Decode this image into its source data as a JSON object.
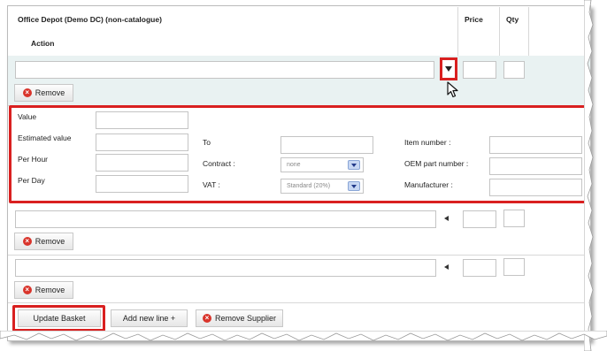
{
  "table": {
    "supplier_title": "Office Depot (Demo DC) (non-catalogue)",
    "col_price": "Price",
    "col_qty": "Qty",
    "col_action": "Action"
  },
  "row_actions": {
    "remove_label": "Remove"
  },
  "details": {
    "value_label": "Value",
    "estimated_value_label": "Estimated value",
    "per_hour_label": "Per Hour",
    "per_day_label": "Per Day",
    "to_label": "To",
    "contract_label": "Contract :",
    "contract_value": "none",
    "vat_label": "VAT :",
    "vat_value": "Standard (20%)",
    "item_number_label": "Item number :",
    "oem_part_number_label": "OEM part number :",
    "manufacturer_label": "Manufacturer :"
  },
  "footer": {
    "update_basket_label": "Update Basket",
    "add_new_line_label": "Add new line +",
    "remove_supplier_label": "Remove Supplier"
  },
  "icons": {
    "remove": "remove-x-icon",
    "collapse": "triangle-left-icon",
    "expand": "triangle-down-icon",
    "select_caret": "chevron-down-icon",
    "pointer": "mouse-cursor-icon"
  },
  "colors": {
    "highlight_border": "#d92020",
    "row_highlight": "#e9f2f2",
    "remove_icon": "#d9342b"
  }
}
